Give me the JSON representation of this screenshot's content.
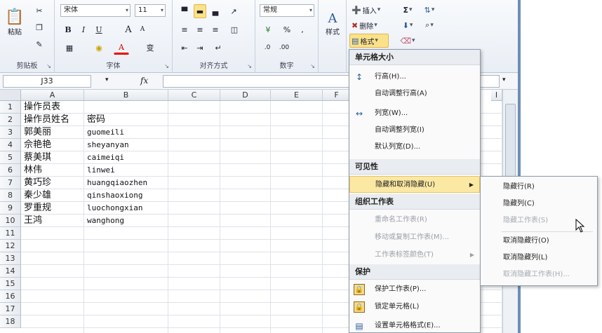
{
  "ribbon": {
    "clipboard": {
      "label": "剪贴板",
      "paste": "粘贴"
    },
    "font": {
      "label": "字体",
      "name": "宋体",
      "size": "11",
      "bold": "B",
      "italic": "I",
      "underline": "U",
      "grow": "A",
      "shrink": "A",
      "color": "A",
      "wen": "变"
    },
    "alignment": {
      "label": "对齐方式"
    },
    "number": {
      "label": "数字",
      "format": "常规",
      "percent": "%"
    },
    "styles": {
      "label": "样式"
    },
    "cells": {
      "insert": "插入",
      "delete": "删除",
      "format": "格式"
    },
    "editing": {
      "sum": "Σ"
    }
  },
  "formula_bar": {
    "name_box": "J33",
    "fx": "fx",
    "value": ""
  },
  "sheet": {
    "columns": [
      "A",
      "B",
      "C",
      "D",
      "E",
      "F",
      "I"
    ],
    "rows": [
      "1",
      "2",
      "3",
      "4",
      "5",
      "6",
      "7",
      "8",
      "9",
      "10",
      "11",
      "12",
      "13",
      "14",
      "15",
      "16",
      "17",
      "18"
    ],
    "data": [
      {
        "a": "操作员表",
        "b": ""
      },
      {
        "a": "操作员姓名",
        "b": "密码"
      },
      {
        "a": "郭美丽",
        "b": "guomeili"
      },
      {
        "a": "佘艳艳",
        "b": "sheyanyan"
      },
      {
        "a": "蔡美琪",
        "b": "caimeiqi"
      },
      {
        "a": "林伟",
        "b": "linwei"
      },
      {
        "a": "黄巧珍",
        "b": "huangqiaozhen"
      },
      {
        "a": "秦少雄",
        "b": "qinshaoxiong"
      },
      {
        "a": "罗重规",
        "b": "luochongxian"
      },
      {
        "a": "王鸿",
        "b": "wanghong"
      }
    ]
  },
  "format_menu": {
    "cell_size_header": "单元格大小",
    "row_height": "行高(H)...",
    "autofit_row": "自动调整行高(A)",
    "column_width": "列宽(W)...",
    "autofit_column": "自动调整列宽(I)",
    "default_width": "默认列宽(D)...",
    "visibility_header": "可见性",
    "hide_unhide": "隐藏和取消隐藏(U)",
    "organize_header": "组织工作表",
    "rename_sheet": "重命名工作表(R)",
    "move_copy": "移动或复制工作表(M)...",
    "tab_color": "工作表标签颜色(T)",
    "protection_header": "保护",
    "protect_sheet": "保护工作表(P)...",
    "lock_cell": "锁定单元格(L)",
    "format_cells": "设置单元格格式(E)..."
  },
  "submenu": {
    "hide_rows": "隐藏行(R)",
    "hide_columns": "隐藏列(C)",
    "hide_sheet": "隐藏工作表(S)",
    "unhide_rows": "取消隐藏行(O)",
    "unhide_columns": "取消隐藏列(L)",
    "unhide_sheet": "取消隐藏工作表(H)..."
  }
}
